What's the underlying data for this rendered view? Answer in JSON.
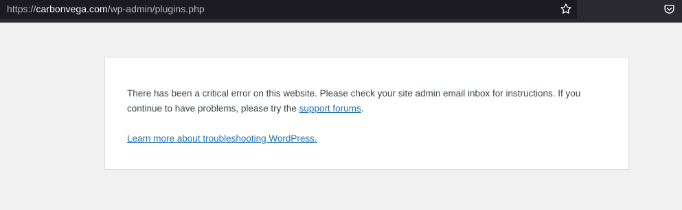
{
  "browser": {
    "url_prefix": "https://",
    "url_domain": "carbonvega.com",
    "url_path": "/wp-admin/plugins.php",
    "icons": {
      "bookmark": "star-icon",
      "pocket": "pocket-icon"
    }
  },
  "error": {
    "message_main": "There has been a critical error on this website. Please check your site admin email inbox for instructions. If you continue to have problems, please try the ",
    "support_link": "support forums",
    "message_end": ".",
    "learn_link": "Learn more about troubleshooting WordPress."
  },
  "colors": {
    "page_bg": "#f1f1f1",
    "link": "#2271b1",
    "text": "#3c434a"
  }
}
